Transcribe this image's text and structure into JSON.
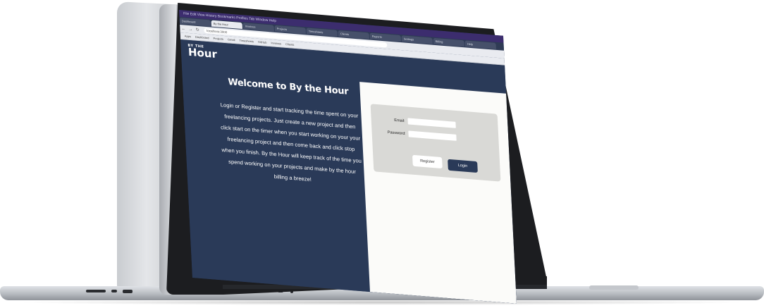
{
  "browser": {
    "title_text": "File  Edit  View  History  Bookmarks  Profiles  Tab  Window  Help",
    "tabs": [
      {
        "label": "Dashboard"
      },
      {
        "label": "By the Hour",
        "active": true
      },
      {
        "label": "Invoices"
      },
      {
        "label": "Projects"
      },
      {
        "label": "Timesheets"
      },
      {
        "label": "Clients"
      },
      {
        "label": "Reports"
      },
      {
        "label": "Settings"
      },
      {
        "label": "Billing"
      },
      {
        "label": "Help"
      }
    ],
    "url": "localhost:3000",
    "bookmarks": [
      "Apps",
      "Dashboard",
      "Projects",
      "Gmail",
      "Timesheets",
      "GitHub",
      "Invoices",
      "Clients"
    ]
  },
  "app": {
    "logo_small": "BY THE",
    "logo_big": "Hour",
    "welcome_title": "Welcome to By the Hour",
    "welcome_text": "Login or Register and start tracking the time spent on your freelancing projects. Just create a new project and then click start on the timer when you start working on your your freelancing project and then come back and click stop when you finish. By the Hour will keep track of the time you spend working on your projects and make by the hour billing a breeze!",
    "login": {
      "email_label": "Email:",
      "password_label": "Password:",
      "email_value": "",
      "password_value": "",
      "register_label": "Register",
      "login_label": "Login"
    }
  },
  "colors": {
    "app_background": "#2a3a58",
    "login_pane": "#fbfbf9",
    "login_card": "#d9d9d6",
    "login_button": "#2a3a58"
  }
}
